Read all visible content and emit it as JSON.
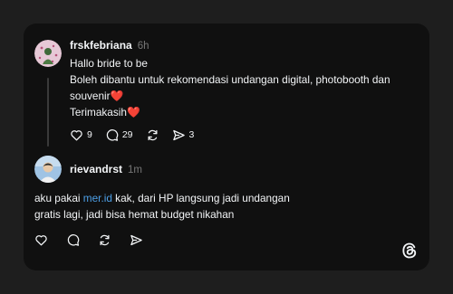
{
  "post": {
    "author": "frskfebriana",
    "time": "6h",
    "lines": [
      "Hallo bride to be",
      "Boleh dibantu untuk rekomendasi undangan digital, photobooth dan souvenir",
      "Terimakasih"
    ],
    "emoji": "❤️",
    "actions": {
      "likes": "9",
      "comments": "29",
      "shares": "3"
    }
  },
  "reply": {
    "author": "rievandrst",
    "time": "1m",
    "text_before_link": "aku pakai ",
    "link_text": "mer.id",
    "text_after_link": " kak, dari HP langsung jadi undangan",
    "line2": "gratis lagi, jadi bisa hemat budget nikahan"
  },
  "icons": {
    "like": "heart-icon",
    "comment": "comment-icon",
    "repost": "repost-icon",
    "share": "send-icon",
    "brand": "threads-logo-icon"
  },
  "colors": {
    "card_bg": "#101010",
    "page_bg": "#1e1e1e",
    "link": "#4d9fe6",
    "muted": "#777777",
    "heart": "#e0245e"
  }
}
